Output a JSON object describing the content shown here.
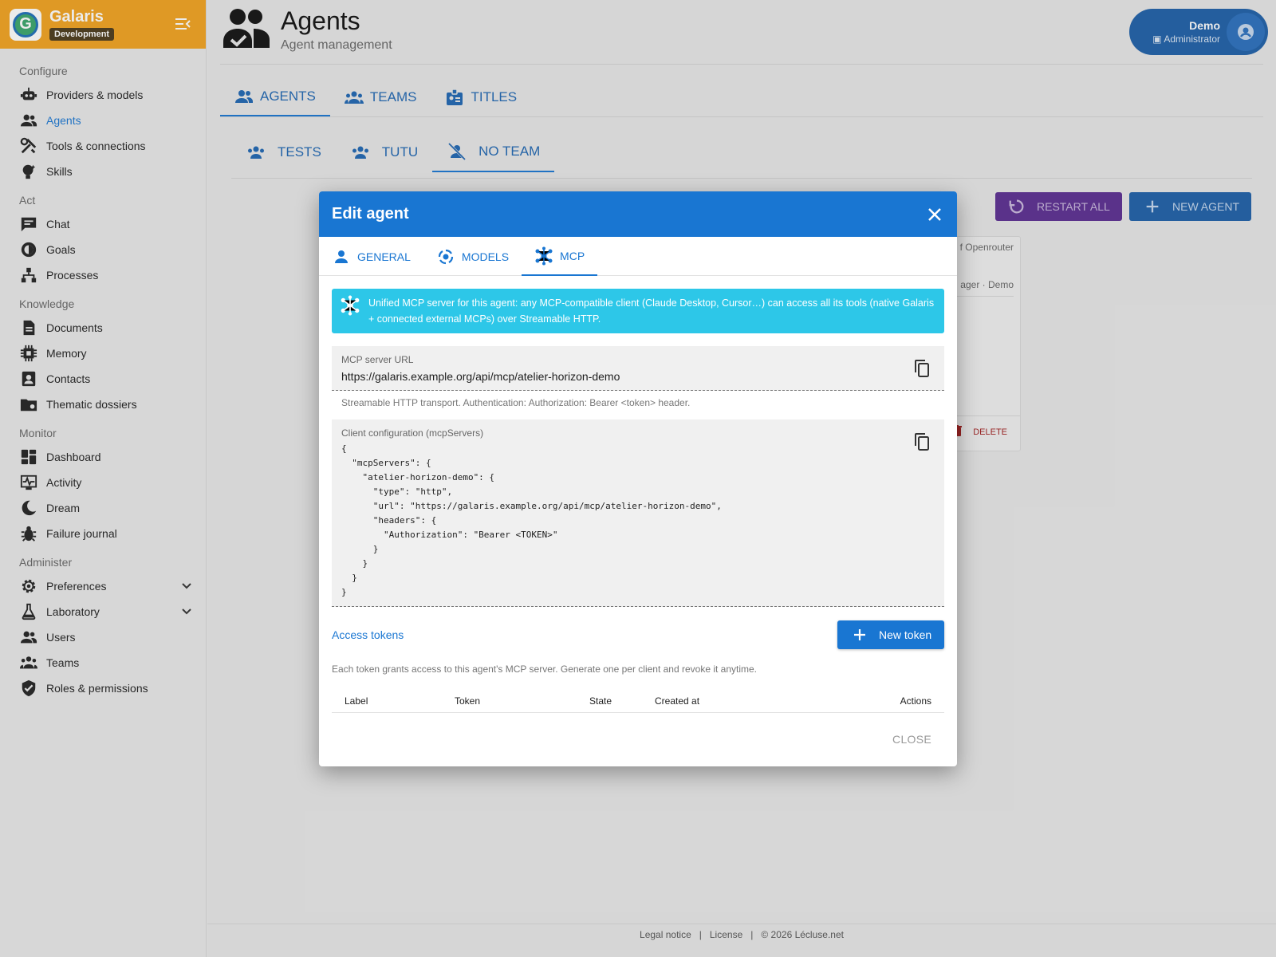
{
  "sidebar": {
    "brand": "Galaris",
    "env_badge": "Development",
    "sections": [
      {
        "title": "Configure",
        "items": [
          {
            "label": "Providers & models",
            "icon": "robot-icon"
          },
          {
            "label": "Agents",
            "icon": "agents-icon",
            "active": true
          },
          {
            "label": "Tools & connections",
            "icon": "tools-icon"
          },
          {
            "label": "Skills",
            "icon": "skills-icon"
          }
        ]
      },
      {
        "title": "Act",
        "items": [
          {
            "label": "Chat",
            "icon": "chat-icon"
          },
          {
            "label": "Goals",
            "icon": "goals-icon"
          },
          {
            "label": "Processes",
            "icon": "processes-icon"
          }
        ]
      },
      {
        "title": "Knowledge",
        "items": [
          {
            "label": "Documents",
            "icon": "document-icon"
          },
          {
            "label": "Memory",
            "icon": "memory-chip-icon"
          },
          {
            "label": "Contacts",
            "icon": "contacts-icon"
          },
          {
            "label": "Thematic dossiers",
            "icon": "folder-icon"
          }
        ]
      },
      {
        "title": "Monitor",
        "items": [
          {
            "label": "Dashboard",
            "icon": "dashboard-icon"
          },
          {
            "label": "Activity",
            "icon": "activity-icon"
          },
          {
            "label": "Dream",
            "icon": "moon-icon"
          },
          {
            "label": "Failure journal",
            "icon": "bug-icon"
          }
        ]
      },
      {
        "title": "Administer",
        "items": [
          {
            "label": "Preferences",
            "icon": "gear-icon",
            "expandable": true
          },
          {
            "label": "Laboratory",
            "icon": "flask-icon",
            "expandable": true
          },
          {
            "label": "Users",
            "icon": "users-icon"
          },
          {
            "label": "Teams",
            "icon": "teams-icon"
          },
          {
            "label": "Roles & permissions",
            "icon": "shield-icon"
          }
        ]
      }
    ]
  },
  "header": {
    "title": "Agents",
    "subtitle": "Agent management",
    "user": {
      "name": "Demo",
      "role": "Administrator"
    }
  },
  "main_tabs": [
    {
      "label": "AGENTS",
      "icon": "agents-icon",
      "active": true
    },
    {
      "label": "TEAMS",
      "icon": "teams-icon"
    },
    {
      "label": "TITLES",
      "icon": "badge-icon"
    }
  ],
  "team_tabs": [
    {
      "label": "TESTS",
      "icon": "teams-icon"
    },
    {
      "label": "TUTU",
      "icon": "teams-icon"
    },
    {
      "label": "NO TEAM",
      "icon": "no-team-icon",
      "active": true
    }
  ],
  "actions": {
    "restart_all": "RESTART ALL",
    "new_agent": "NEW AGENT"
  },
  "card": {
    "line1": "f Openrouter",
    "line2": "ager · Demo",
    "delete": "DELETE"
  },
  "dialog": {
    "title": "Edit agent",
    "tabs": [
      {
        "label": "GENERAL",
        "icon": "person-icon"
      },
      {
        "label": "MODELS",
        "icon": "model-cycle-icon"
      },
      {
        "label": "MCP",
        "icon": "mcp-hub-icon",
        "active": true
      }
    ],
    "info": "Unified MCP server for this agent: any MCP-compatible client (Claude Desktop, Cursor…) can access all its tools (native Galaris + connected external MCPs) over Streamable HTTP.",
    "url_field": {
      "label": "MCP server URL",
      "value": "https://galaris.example.org/api/mcp/atelier-horizon-demo",
      "hint": "Streamable HTTP transport. Authentication: Authorization: Bearer <token> header."
    },
    "config_field": {
      "label": "Client configuration (mcpServers)",
      "code": "{\n  \"mcpServers\": {\n    \"atelier-horizon-demo\": {\n      \"type\": \"http\",\n      \"url\": \"https://galaris.example.org/api/mcp/atelier-horizon-demo\",\n      \"headers\": {\n        \"Authorization\": \"Bearer <TOKEN>\"\n      }\n    }\n  }\n}"
    },
    "tokens": {
      "title": "Access tokens",
      "new_button": "New token",
      "hint": "Each token grants access to this agent's MCP server. Generate one per client and revoke it anytime.",
      "columns": [
        "Label",
        "Token",
        "State",
        "Created at",
        "Actions"
      ]
    },
    "close": "CLOSE"
  },
  "footer": {
    "legal": "Legal notice",
    "license": "License",
    "copyright": "© 2026 Lécluse.net"
  },
  "colors": {
    "accent": "#1976d2",
    "header_orange": "#f2a21e",
    "info": "#2dc7e8",
    "restart": "#5b2d91"
  }
}
